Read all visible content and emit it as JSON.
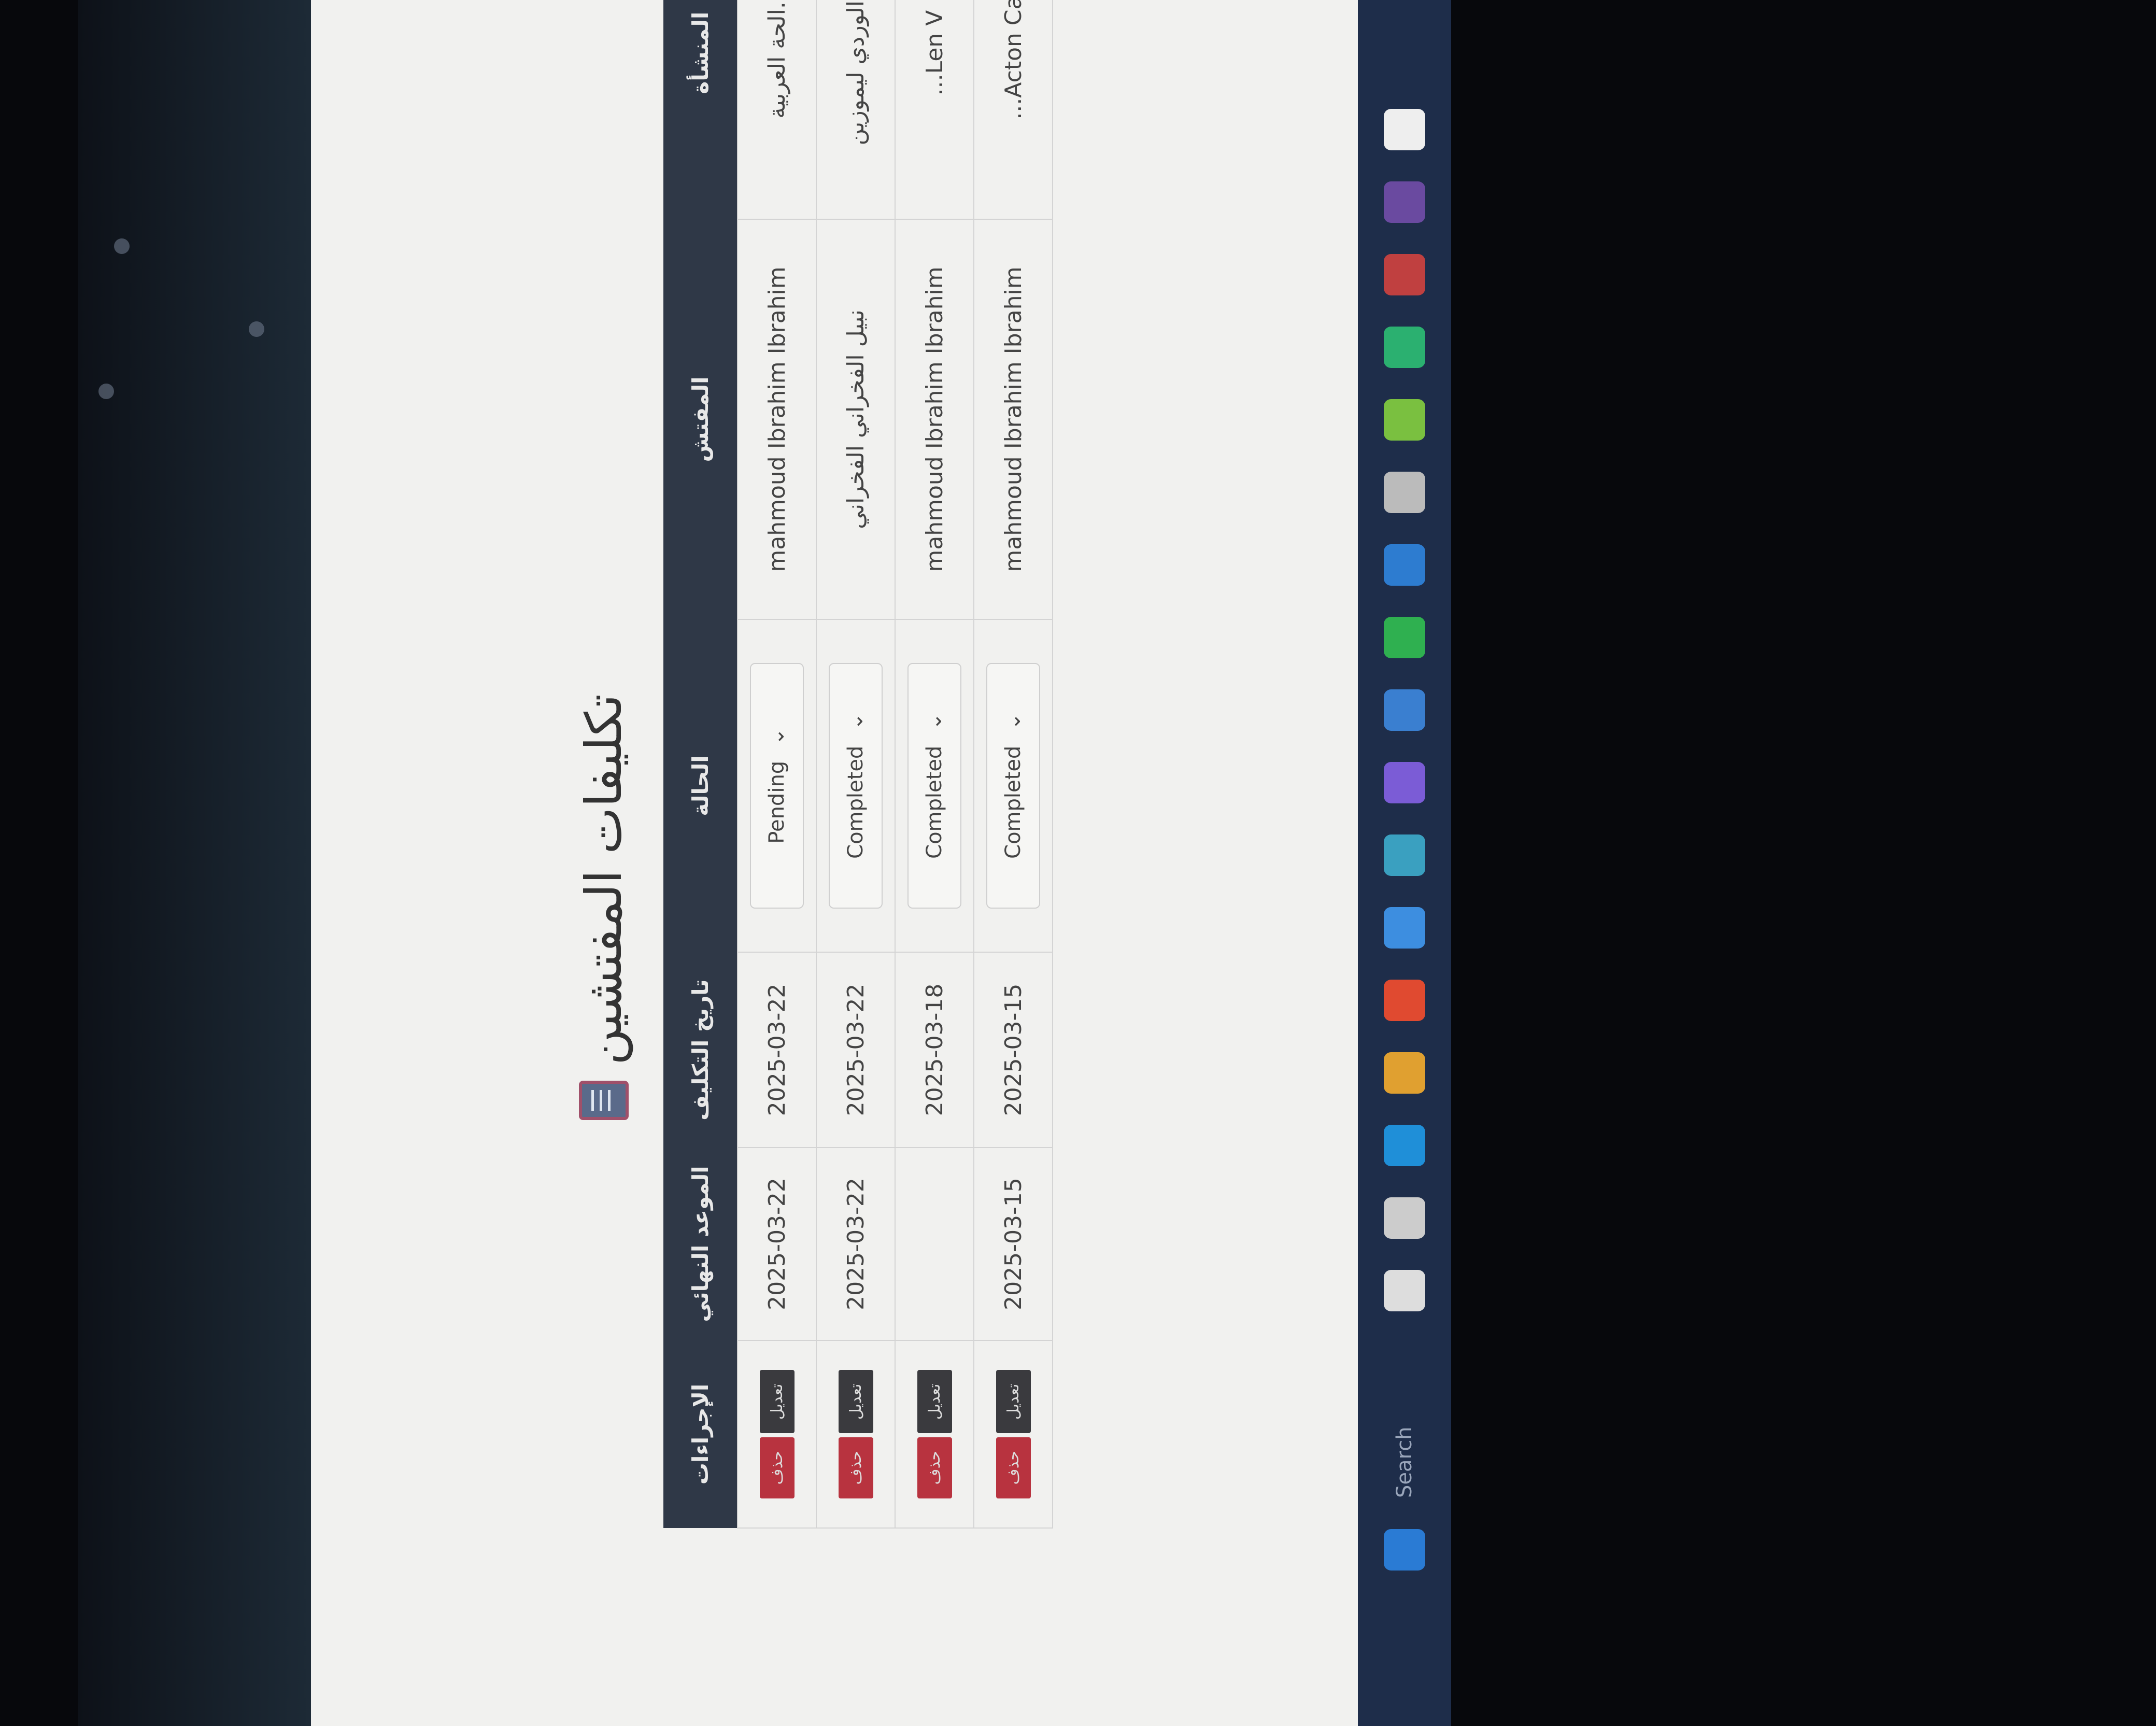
{
  "page": {
    "title": "تكليفات المفتشين"
  },
  "table": {
    "headers": [
      "المنشأة",
      "المفتش",
      "الحالة",
      "تاريخ التكليف",
      "الموعد النهائي",
      "الإجراءات"
    ],
    "rows": [
      {
        "facility": "...الحة العربية",
        "inspector": "mahmoud Ibrahim Ibrahim",
        "status": "Pending",
        "assigned": "2025-03-22",
        "due": "2025-03-22"
      },
      {
        "facility": "...ر الوردي ليموزين",
        "inspector": "نبيل الفخراني الفخراني",
        "status": "Completed",
        "assigned": "2025-03-22",
        "due": "2025-03-22"
      },
      {
        "facility": "Len V...",
        "inspector": "mahmoud Ibrahim Ibrahim",
        "status": "Completed",
        "assigned": "2025-03-18",
        "due": ""
      },
      {
        "facility": "Acton Car...",
        "inspector": "mahmoud Ibrahim Ibrahim",
        "status": "Completed",
        "assigned": "2025-03-15",
        "due": "2025-03-15"
      }
    ],
    "edit_label": "تعديل",
    "delete_label": "حذف"
  },
  "taskbar": {
    "search_label": "Search",
    "icons": [
      "windows-icon",
      "search-icon",
      "widgets-icon",
      "task-view-icon",
      "edge-icon",
      "file-explorer-icon",
      "chrome-icon",
      "firefox-icon",
      "app-icon",
      "visual-studio-icon",
      "app-icon",
      "whatsapp-icon",
      "vscode-icon",
      "settings-icon",
      "upwork-icon",
      "pycharm-icon",
      "app-icon",
      "winrar-icon",
      "notes-icon"
    ]
  },
  "colors": {
    "header": "#2f3847",
    "delete": "#b8333f",
    "edit": "#3a3a3e",
    "taskbar": "#1e2d4a"
  }
}
